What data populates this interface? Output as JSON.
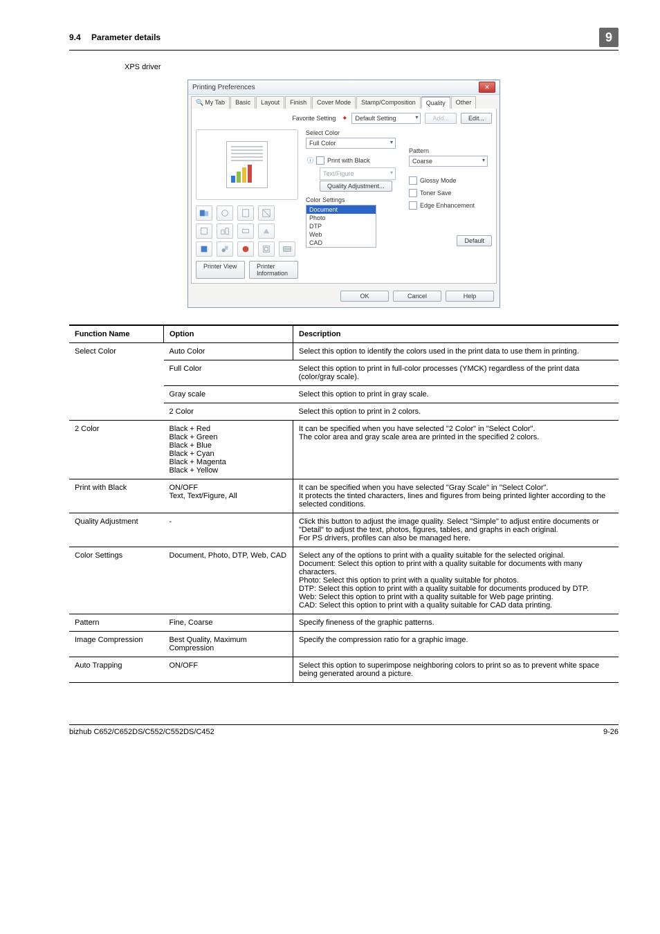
{
  "header": {
    "section": "9.4",
    "title": "Parameter details",
    "chapter": "9"
  },
  "driver_label": "XPS driver",
  "dialog": {
    "title": "Printing Preferences",
    "tabs": [
      "My Tab",
      "Basic",
      "Layout",
      "Finish",
      "Cover Mode",
      "Stamp/Composition",
      "Quality",
      "Other"
    ],
    "active_tab": "Quality",
    "favorite": {
      "label": "Favorite Setting",
      "value": "Default Setting",
      "add": "Add...",
      "edit": "Edit..."
    },
    "select_color": {
      "label": "Select Color",
      "value": "Full Color"
    },
    "print_with_black": {
      "checkbox": "Print with Black",
      "dropdown": "Text/Figure",
      "button": "Quality Adjustment..."
    },
    "color_settings": {
      "label": "Color Settings",
      "items": [
        "Document",
        "Photo",
        "DTP",
        "Web",
        "CAD"
      ],
      "selected": "Document"
    },
    "pattern": {
      "label": "Pattern",
      "value": "Coarse"
    },
    "checks": {
      "glossy": "Glossy Mode",
      "toner": "Toner Save",
      "edge": "Edge Enhancement"
    },
    "printer_view": "Printer View",
    "printer_info": "Printer Information",
    "default": "Default",
    "ok": "OK",
    "cancel": "Cancel",
    "help": "Help"
  },
  "table": {
    "headers": [
      "Function Name",
      "Option",
      "Description"
    ],
    "rows": [
      {
        "fn": "Select Color",
        "rowspan": 4,
        "option": "Auto Color",
        "desc": "Select this option to identify the colors used in the print data to use them in printing."
      },
      {
        "option": "Full Color",
        "desc": "Select this option to print in full-color processes (YMCK) regardless of the print data (color/gray scale)."
      },
      {
        "option": "Gray scale",
        "desc": "Select this option to print in gray scale."
      },
      {
        "option": "2 Color",
        "desc": "Select this option to print in 2 colors."
      },
      {
        "fn": "2 Color",
        "option": "Black + Red\nBlack + Green\nBlack + Blue\nBlack + Cyan\nBlack + Magenta\nBlack + Yellow",
        "desc": "It can be specified when you have selected \"2 Color\" in \"Select Color\".\nThe color area and gray scale area are printed in the specified 2 colors."
      },
      {
        "fn": "Print with Black",
        "option": "ON/OFF\nText, Text/Figure, All",
        "desc": "It can be specified when you have selected \"Gray Scale\" in \"Select Color\".\nIt protects the tinted characters, lines and figures from being printed lighter according to the selected conditions."
      },
      {
        "fn": "Quality Adjustment",
        "option": "-",
        "desc": "Click this button to adjust the image quality. Select \"Simple\" to adjust entire documents or \"Detail\" to adjust the text, photos, figures, tables, and graphs in each original.\nFor PS drivers, profiles can also be managed here."
      },
      {
        "fn": "Color Settings",
        "option": "Document, Photo, DTP, Web, CAD",
        "desc": "Select any of the options to print with a quality suitable for the selected original.\nDocument: Select this option to print with a quality suitable for documents with many characters.\nPhoto: Select this option to print with a quality suitable for photos.\nDTP: Select this option to print with a quality suitable for documents produced by DTP.\nWeb: Select this option to print with a quality suitable for Web page printing.\nCAD: Select this option to print with a quality suitable for CAD data printing."
      },
      {
        "fn": "Pattern",
        "option": "Fine, Coarse",
        "desc": "Specify fineness of the graphic patterns."
      },
      {
        "fn": "Image Compression",
        "option": "Best Quality, Maximum Compression",
        "desc": "Specify the compression ratio for a graphic image."
      },
      {
        "fn": "Auto Trapping",
        "option": "ON/OFF",
        "desc": "Select this option to superimpose neighboring colors to print so as to prevent white space being generated around a picture."
      }
    ]
  },
  "footer": {
    "left": "bizhub C652/C652DS/C552/C552DS/C452",
    "right": "9-26"
  }
}
